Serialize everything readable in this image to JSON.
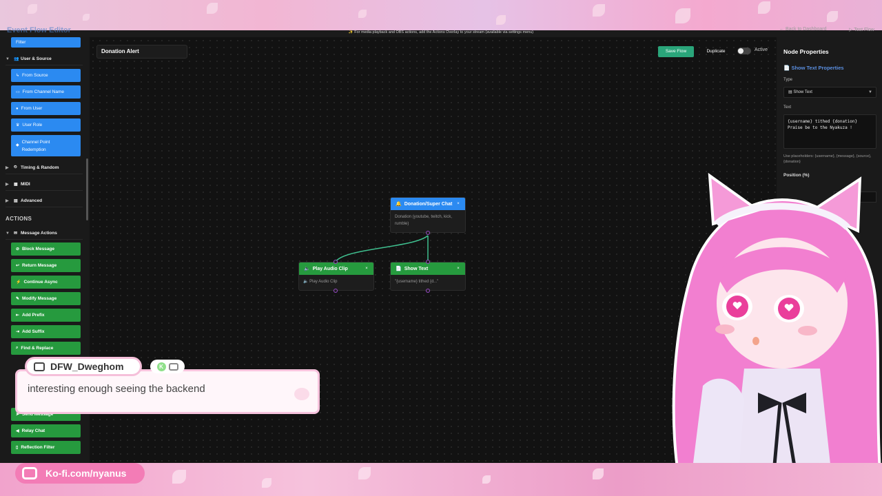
{
  "app": {
    "title": "Event Flow Editor",
    "banner": "✨ For media playback and OBS actions, add the Actions Overlay to your stream (available via settings menu)",
    "back_link": "← Back to Dashboard",
    "test_flow": "▷ Test Flow"
  },
  "sidebar": {
    "filter_label": "Filter",
    "user_source": {
      "label": "User & Source",
      "items": [
        "From Source",
        "From Channel Name",
        "From User",
        "User Role",
        "Channel Point Redemption"
      ]
    },
    "groups": [
      "Timing & Random",
      "MIDI",
      "Advanced"
    ],
    "actions_heading": "ACTIONS",
    "message_actions": {
      "label": "Message Actions",
      "items": [
        "Block Message",
        "Return Message",
        "Continue Async",
        "Modify Message",
        "Add Prefix",
        "Add Suffix",
        "Find & Replace",
        "Send Message",
        "Relay Chat",
        "Reflection Filter"
      ]
    }
  },
  "toolbar": {
    "flow_name": "Donation Alert",
    "save_label": "Save Flow",
    "duplicate_label": "Duplicate",
    "active_label": "Active",
    "active": false
  },
  "nodes": {
    "trigger": {
      "title": "Donation/Super Chat",
      "body": "Donation (youtube, twitch, kick, rumble)"
    },
    "audio": {
      "title": "Play Audio Clip",
      "body": "Play Audio Clip"
    },
    "text": {
      "title": "Show Text",
      "body": "\"{username} tithed {d...\""
    }
  },
  "properties": {
    "title": "Node Properties",
    "subtitle": "Show Text Properties",
    "type_label": "Type",
    "type_value": "Show Text",
    "text_label": "Text",
    "text_value": "{username} tithed {donation}\nPraise be to the Nyakuza !",
    "help": "Use placeholders: {username}, {message}, {source}, {donation}",
    "position_label": "Position (%)"
  },
  "chat": {
    "username": "DFW_Dweghom",
    "badge": "K",
    "message": "interesting enough seeing the backend"
  },
  "kofi": {
    "label": "Ko-fi.com/nyanus"
  },
  "colors": {
    "blue": "#2b8af1",
    "green": "#269a3e",
    "save": "#2aa57a",
    "accent_pink": "#f37cb6",
    "port": "#9a4bc9",
    "edge": "#3fbf8f"
  }
}
